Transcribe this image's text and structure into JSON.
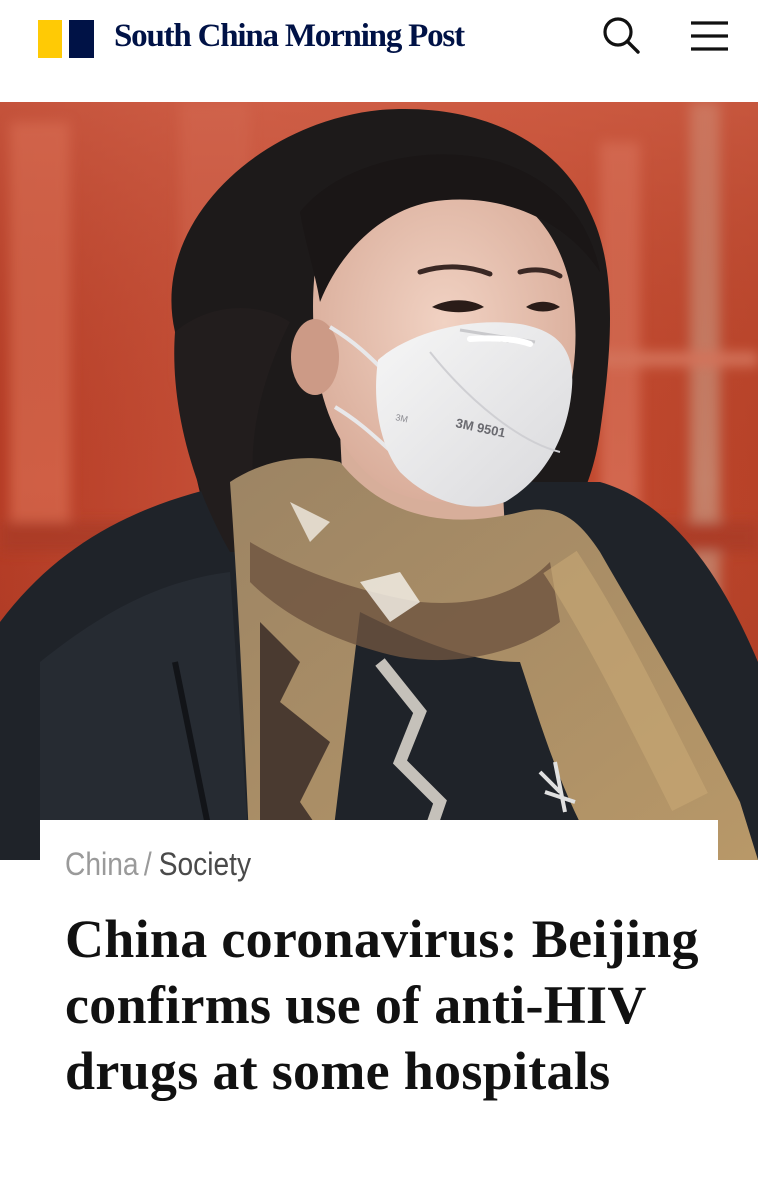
{
  "header": {
    "site_name": "South China Morning Post",
    "brand_colors": {
      "yellow": "#FFCA05",
      "navy": "#001246"
    },
    "search_icon": "search-icon",
    "menu_icon": "hamburger-menu-icon"
  },
  "hero_image": {
    "dominant_colors": [
      "#c0482f",
      "#1f2228",
      "#a88a62",
      "#ececec"
    ]
  },
  "article": {
    "breadcrumb": {
      "section": "China",
      "separator": "/",
      "subsection": "Society"
    },
    "headline": "China coronavirus: Beijing confirms use of anti-HIV drugs at some hospitals"
  }
}
